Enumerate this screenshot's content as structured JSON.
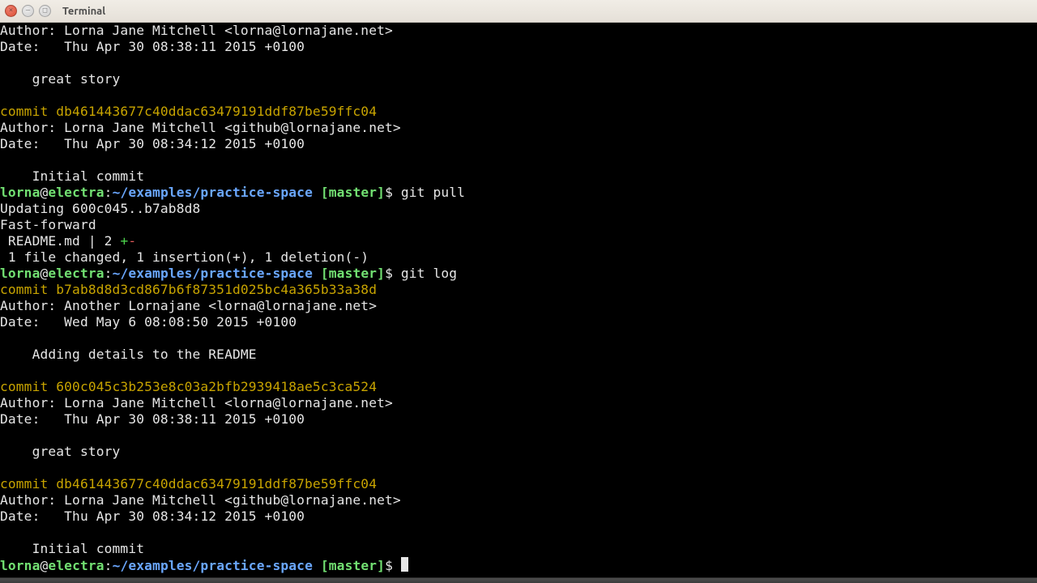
{
  "window": {
    "title": "Terminal"
  },
  "prompt": {
    "user": "lorna",
    "host": "electra",
    "path": "~/examples/practice-space",
    "branch": "[master]",
    "sep_at": "@",
    "sep_colon": ":",
    "dollar": "$"
  },
  "cmd": {
    "pull": " git pull",
    "log": " git log"
  },
  "log_top": {
    "author": "Author: Lorna Jane Mitchell <lorna@lornajane.net>",
    "date": "Date:   Thu Apr 30 08:38:11 2015 +0100",
    "msg": "    great story"
  },
  "c_db": {
    "line": "commit db461443677c40ddac63479191ddf87be59ffc04",
    "author": "Author: Lorna Jane Mitchell <github@lornajane.net>",
    "date": "Date:   Thu Apr 30 08:34:12 2015 +0100",
    "msg": "    Initial commit"
  },
  "pull_out": {
    "updating": "Updating 600c045..b7ab8d8",
    "ff": "Fast-forward",
    "file": " README.md | 2 ",
    "plus": "+",
    "minus": "-",
    "summary": " 1 file changed, 1 insertion(+), 1 deletion(-)"
  },
  "c_b7": {
    "line": "commit b7ab8d8d3cd867b6f87351d025bc4a365b33a38d",
    "author": "Author: Another Lornajane <lorna@lornajane.net>",
    "date": "Date:   Wed May 6 08:08:50 2015 +0100",
    "msg": "    Adding details to the README"
  },
  "c_600": {
    "line": "commit 600c045c3b253e8c03a2bfb2939418ae5c3ca524",
    "author": "Author: Lorna Jane Mitchell <lorna@lornajane.net>",
    "date": "Date:   Thu Apr 30 08:38:11 2015 +0100",
    "msg": "    great story"
  }
}
